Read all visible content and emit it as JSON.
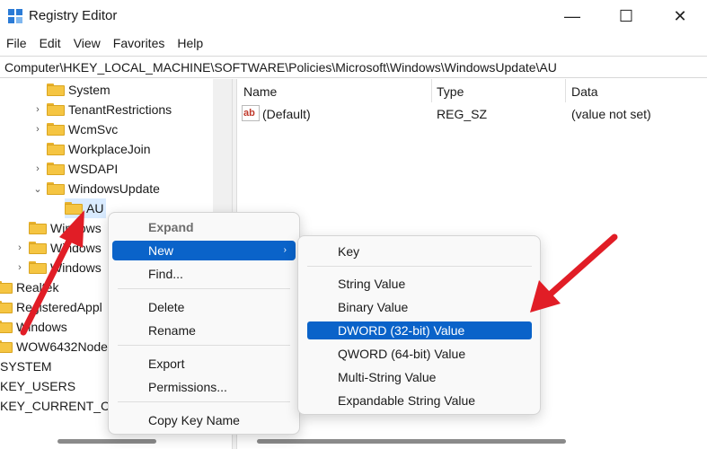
{
  "window": {
    "title": "Registry Editor",
    "minimize_glyph": "—",
    "maximize_glyph": "☐",
    "close_glyph": "✕"
  },
  "menubar": [
    "File",
    "Edit",
    "View",
    "Favorites",
    "Help"
  ],
  "address": "Computer\\HKEY_LOCAL_MACHINE\\SOFTWARE\\Policies\\Microsoft\\Windows\\WindowsUpdate\\AU",
  "tree": {
    "items": [
      {
        "label": "System",
        "chevron": ""
      },
      {
        "label": "TenantRestrictions",
        "chevron": "›"
      },
      {
        "label": "WcmSvc",
        "chevron": "›"
      },
      {
        "label": "WorkplaceJoin",
        "chevron": ""
      },
      {
        "label": "WSDAPI",
        "chevron": "›"
      },
      {
        "label": "WindowsUpdate",
        "chevron": "⌄"
      },
      {
        "label": "AU",
        "chevron": ""
      },
      {
        "label": "Windows",
        "chevron": ""
      },
      {
        "label": "Windows",
        "chevron": "›"
      },
      {
        "label": "Windows",
        "chevron": "›"
      },
      {
        "label": "Realtek",
        "chevron": ""
      },
      {
        "label": "RegisteredAppl",
        "chevron": ""
      },
      {
        "label": "Windows",
        "chevron": ""
      },
      {
        "label": "WOW6432Node",
        "chevron": ""
      },
      {
        "label": "SYSTEM",
        "chevron": ""
      },
      {
        "label": "KEY_USERS",
        "chevron": ""
      },
      {
        "label": "KEY_CURRENT_CON",
        "chevron": ""
      }
    ]
  },
  "list": {
    "columns": [
      "Name",
      "Type",
      "Data"
    ],
    "rows": [
      {
        "name": "(Default)",
        "type": "REG_SZ",
        "data": "(value not set)",
        "icon": "ab-icon"
      }
    ]
  },
  "context_menu": {
    "items": [
      "Expand",
      "New",
      "Find...",
      "Delete",
      "Rename",
      "Export",
      "Permissions...",
      "Copy Key Name"
    ],
    "submenu_arrow": "›"
  },
  "submenu": {
    "items": [
      "Key",
      "String Value",
      "Binary Value",
      "DWORD (32-bit) Value",
      "QWORD (64-bit) Value",
      "Multi-String Value",
      "Expandable String Value"
    ]
  },
  "colors": {
    "accent": "#0a63c9",
    "annotation": "#e11d26",
    "folder": "#f5c542"
  }
}
